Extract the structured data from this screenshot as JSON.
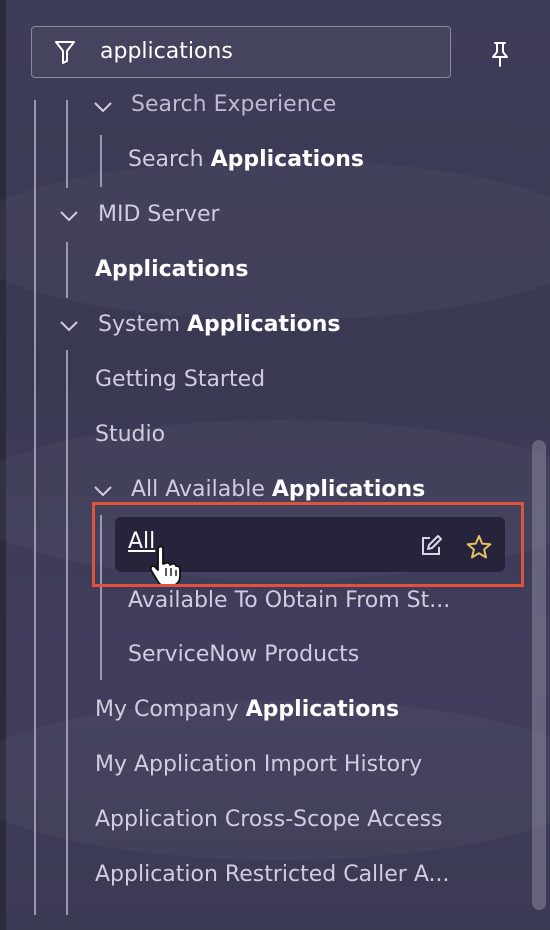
{
  "search": {
    "value": "applications",
    "icon": "filter-icon"
  },
  "pin": {
    "icon": "pin-icon"
  },
  "tree": {
    "search_experience": {
      "label": "Search Experience"
    },
    "search_applications": {
      "pre": "Search ",
      "bold": "Applications"
    },
    "mid_server": {
      "label": "MID Server"
    },
    "mid_applications": {
      "bold": "Applications"
    },
    "system_applications": {
      "pre": "System ",
      "bold": "Applications"
    },
    "getting_started": {
      "label": "Getting Started"
    },
    "studio": {
      "label": "Studio"
    },
    "all_available": {
      "pre": "All Available ",
      "bold": "Applications"
    },
    "all": {
      "label": "All",
      "edit_icon": "edit-icon",
      "star_icon": "star-icon"
    },
    "available_to_obtain": {
      "label": "Available To Obtain From St..."
    },
    "servicenow_products": {
      "label": "ServiceNow Products"
    },
    "my_company": {
      "pre": "My Company ",
      "bold": "Applications"
    },
    "import_history": {
      "label": "My Application Import History"
    },
    "cross_scope": {
      "label": "Application Cross-Scope Access"
    },
    "restricted_caller": {
      "label": "Application Restricted Caller A..."
    }
  },
  "colors": {
    "highlight_border": "#e0533a",
    "selected_bg": "#25243a",
    "panel_bg": "#3e3d59"
  }
}
